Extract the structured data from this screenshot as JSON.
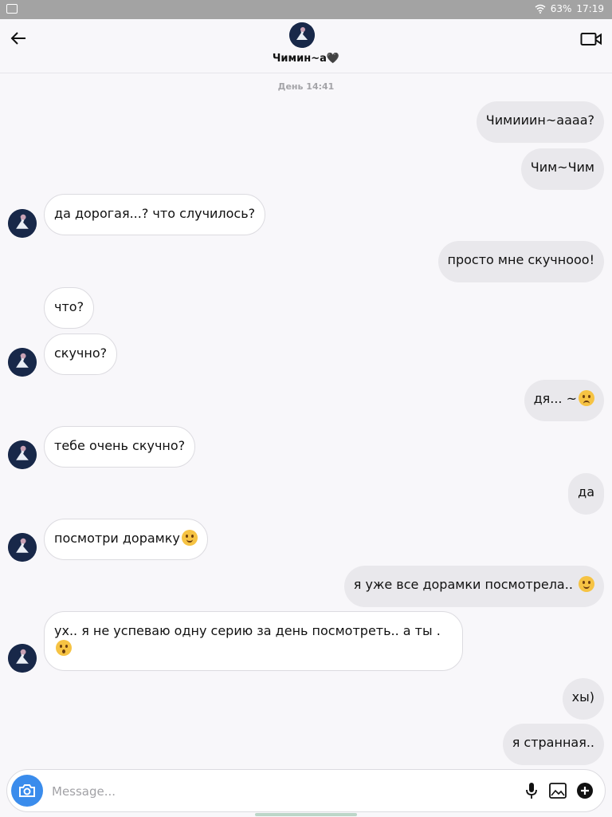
{
  "status_bar": {
    "battery": "63%",
    "time": "17:19"
  },
  "header": {
    "contact_name": "Чимин~а🖤"
  },
  "date_label": "День 14:41",
  "messages": [
    {
      "text": "Чимииин~аааа?"
    },
    {
      "text": "Чим~Чим"
    },
    {
      "text": "да дорогая...? что случилось?"
    },
    {
      "text": "просто мне скучнооо!"
    },
    {
      "text": "что?"
    },
    {
      "text": "скучно?"
    },
    {
      "text": "дя... ~"
    },
    {
      "text": "тебе очень скучно?"
    },
    {
      "text": "да"
    },
    {
      "text": "посмотри дорамку"
    },
    {
      "text": "я уже все дорамки посмотрела.."
    },
    {
      "text": "ух.. я не успеваю одну серию за день посмотреть.. а ты ."
    },
    {
      "text": "хы)"
    },
    {
      "text": "я странная.."
    }
  ],
  "composer": {
    "placeholder": "Message..."
  },
  "icons": {
    "back": "back-arrow-icon",
    "video": "video-call-icon",
    "camera": "camera-icon",
    "mic": "microphone-icon",
    "gallery": "gallery-icon",
    "add": "plus-circle-icon"
  },
  "colors": {
    "accent": "#3a8cec",
    "outgoing_bubble": "#e9e8ec",
    "incoming_bubble": "#ffffff",
    "background": "#f8f7fa"
  }
}
